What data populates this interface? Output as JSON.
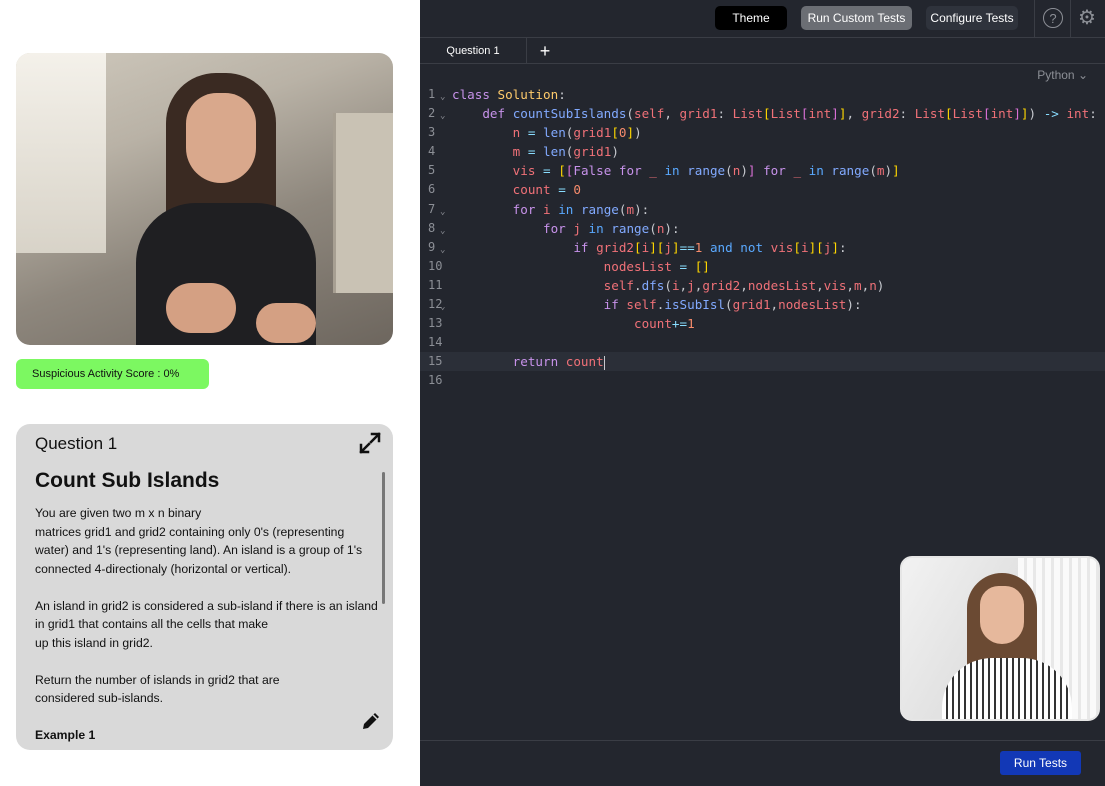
{
  "toolbar": {
    "theme_label": "Theme",
    "custom_tests_label": "Run Custom Tests",
    "configure_tests_label": "Configure Tests",
    "help_icon": "?",
    "settings_icon": "gear-icon"
  },
  "tabs": {
    "active": "Question 1",
    "add_symbol": "+"
  },
  "language": "Python ⌄",
  "score": {
    "label": "Suspicious Activity Score : 0%",
    "color": "#7cf861"
  },
  "question": {
    "number": "Question 1",
    "title": "Count Sub Islands",
    "paragraphs": [
      "You are given two m x n binary\nmatrices grid1 and grid2 containing only 0's (representing water) and 1's (representing land). An island is a group of 1's connected 4-directionaly (horizontal or vertical).",
      "An island in grid2 is considered a sub-island if there is an island in grid1 that contains all the cells that make\nup this island in grid2.",
      "Return the number of islands in grid2 that are\nconsidered sub-islands."
    ],
    "example_heading": "Example 1"
  },
  "code": {
    "line_numbers": [
      "1",
      "2",
      "3",
      "4",
      "5",
      "6",
      "7",
      "8",
      "9",
      "10",
      "11",
      "12",
      "13",
      "14",
      "15",
      "16"
    ],
    "folded_lines": [
      1,
      2,
      7,
      8,
      9,
      12
    ],
    "active_line": 15
  },
  "footer": {
    "run_tests_label": "Run Tests",
    "accent": "#1238b6"
  }
}
